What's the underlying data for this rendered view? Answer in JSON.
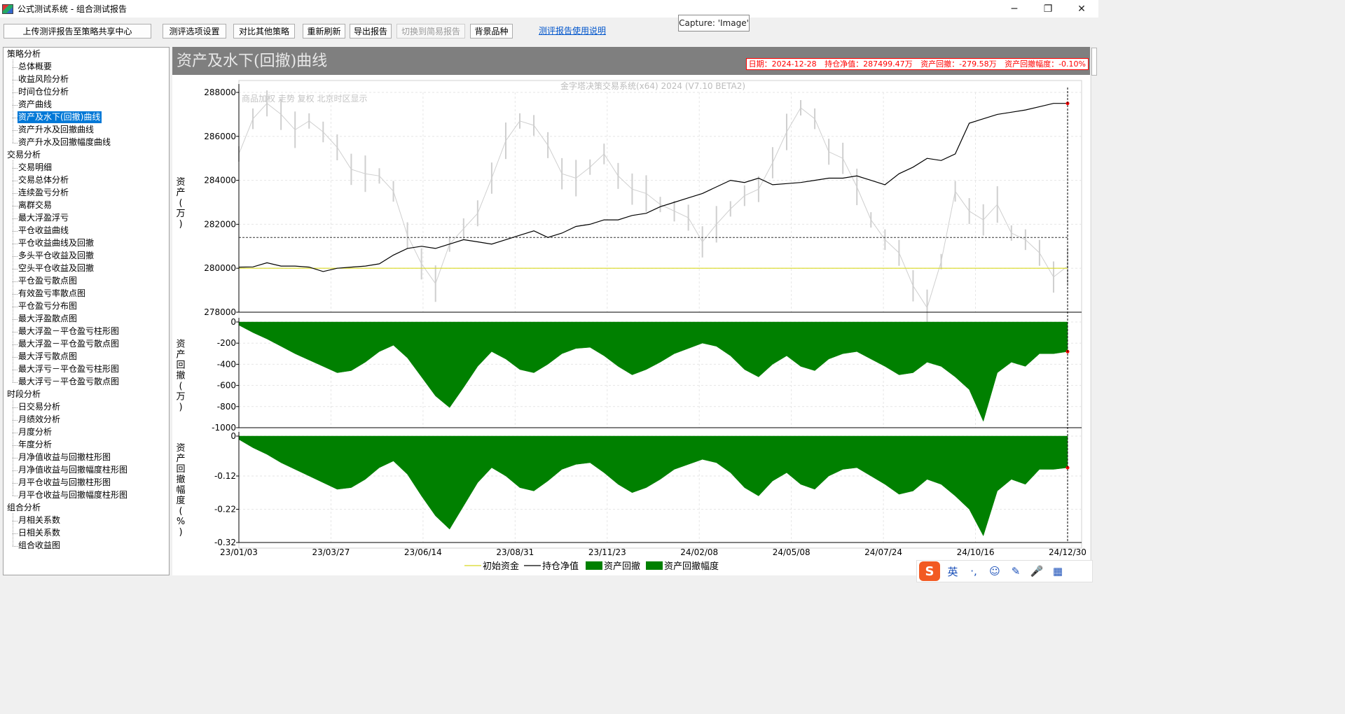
{
  "window": {
    "title": "公式测试系统 - 组合测试报告",
    "controls": {
      "minimize": "─",
      "restore": "❐",
      "close": "✕"
    }
  },
  "toolbar": {
    "upload": "上传测评报告至策略共享中心",
    "settings": "测评选项设置",
    "compare": "对比其他策略",
    "refresh": "重新刷新",
    "export": "导出报告",
    "switch_simple": "切换到简易报告",
    "background": "背景品种",
    "help_link": "测评报告使用说明"
  },
  "tooltip": {
    "text": "Capture: 'Image'"
  },
  "sidebar": {
    "groups": [
      {
        "label": "策略分析",
        "items": [
          "总体概要",
          "收益风险分析",
          "时间仓位分析",
          "资产曲线",
          "资产及水下(回撤)曲线",
          "资产升水及回撤曲线",
          "资产升水及回撤幅度曲线"
        ]
      },
      {
        "label": "交易分析",
        "items": [
          "交易明细",
          "交易总体分析",
          "连续盈亏分析",
          "离群交易",
          "最大浮盈浮亏",
          "平仓收益曲线",
          "平仓收益曲线及回撤",
          "多头平仓收益及回撤",
          "空头平仓收益及回撤",
          "平仓盈亏散点图",
          "有效盈亏率散点图",
          "平仓盈亏分布图",
          "最大浮盈散点图",
          "最大浮盈－平仓盈亏柱形图",
          "最大浮盈－平仓盈亏散点图",
          "最大浮亏散点图",
          "最大浮亏－平仓盈亏柱形图",
          "最大浮亏－平仓盈亏散点图"
        ]
      },
      {
        "label": "时段分析",
        "items": [
          "日交易分析",
          "月绩效分析",
          "月度分析",
          "年度分析",
          "月净值收益与回撤柱形图",
          "月净值收益与回撤幅度柱形图",
          "月平仓收益与回撤柱形图",
          "月平仓收益与回撤幅度柱形图"
        ]
      },
      {
        "label": "组合分析",
        "items": [
          "月相关系数",
          "日相关系数",
          "组合收益图"
        ]
      }
    ],
    "selected": "资产及水下(回撤)曲线"
  },
  "panel": {
    "title": "资产及水下(回撤)曲线",
    "info": {
      "date": "日期：2024-12-28",
      "net_value": "持仓净值：287499.47万",
      "drawdown": "资产回撤：-279.58万",
      "drawdown_pct": "资产回撤幅度：-0.10%"
    }
  },
  "chart_data": {
    "type": "line",
    "watermark": "金字塔决策交易系统(x64) 2024 (V7.10 BETA2)",
    "background_note": "商品加权 走势 复权 北京时区显示",
    "x_ticks": [
      "23/01/03",
      "23/03/27",
      "23/06/14",
      "23/08/31",
      "23/11/23",
      "24/02/08",
      "24/05/08",
      "24/07/24",
      "24/10/16",
      "24/12/30"
    ],
    "legend": [
      "初始资金",
      "持仓净值",
      "资产回撤",
      "资产回撤幅度"
    ],
    "colors": {
      "initial": "#d8d820",
      "net": "#000000",
      "background": "#cfcfcf",
      "drawdown": "#008000",
      "marker": "#ff0000"
    },
    "panels": [
      {
        "ylabel": "资产(万)",
        "ylim": [
          278000,
          288000
        ],
        "yticks": [
          278000,
          280000,
          282000,
          284000,
          286000,
          288000
        ],
        "initial_capital": 280000,
        "reference_line": 281400,
        "series": [
          {
            "name": "持仓净值",
            "values": [
              280050,
              280060,
              280250,
              280100,
              280100,
              280050,
              279850,
              280000,
              280050,
              280100,
              280200,
              280600,
              280900,
              281000,
              280900,
              281100,
              281300,
              281200,
              281100,
              281300,
              281500,
              281700,
              281400,
              281600,
              281900,
              282000,
              282200,
              282200,
              282400,
              282500,
              282800,
              283000,
              283200,
              283400,
              283700,
              284000,
              283900,
              284100,
              283800,
              283850,
              283900,
              284000,
              284100,
              284100,
              284200,
              284000,
              283800,
              284300,
              284600,
              285000,
              284900,
              285200,
              286600,
              286800,
              287000,
              287100,
              287200,
              287350,
              287500,
              287499
            ]
          }
        ],
        "background_series": [
          285200,
          286800,
          287500,
          287000,
          286300,
          286700,
          286200,
          285500,
          284500,
          284300,
          284200,
          283500,
          281500,
          280200,
          279300,
          281100,
          281800,
          282500,
          284100,
          285800,
          286700,
          286500,
          285600,
          284300,
          284100,
          284600,
          285200,
          284200,
          283600,
          283400,
          282900,
          282600,
          282300,
          281200,
          282000,
          282700,
          283300,
          283600,
          284800,
          286200,
          287300,
          286800,
          285300,
          285000,
          283700,
          282200,
          281300,
          280700,
          279200,
          278200,
          280300,
          283500,
          282600,
          282200,
          282900,
          281600,
          281300,
          280700,
          279600,
          280100
        ]
      },
      {
        "ylabel": "资产回撤(万)",
        "ylim": [
          -1000,
          0
        ],
        "yticks": [
          0,
          -200,
          -400,
          -600,
          -800,
          -1000
        ],
        "series": [
          {
            "name": "资产回撤",
            "values": [
              -30,
              -100,
              -160,
              -230,
              -300,
              -360,
              -420,
              -480,
              -460,
              -380,
              -280,
              -220,
              -340,
              -520,
              -700,
              -810,
              -620,
              -420,
              -280,
              -350,
              -450,
              -480,
              -400,
              -300,
              -250,
              -240,
              -320,
              -420,
              -500,
              -450,
              -380,
              -300,
              -250,
              -200,
              -230,
              -320,
              -450,
              -520,
              -400,
              -320,
              -420,
              -460,
              -350,
              -300,
              -280,
              -350,
              -420,
              -500,
              -480,
              -380,
              -420,
              -520,
              -640,
              -940,
              -480,
              -380,
              -420,
              -300,
              -300,
              -280
            ]
          }
        ]
      },
      {
        "ylabel": "资产回撤幅度(%)",
        "ylim": [
          -0.32,
          0
        ],
        "yticks": [
          0,
          -0.12,
          -0.22,
          -0.32
        ],
        "series": [
          {
            "name": "资产回撤幅度",
            "values": [
              -0.01,
              -0.035,
              -0.055,
              -0.08,
              -0.1,
              -0.12,
              -0.14,
              -0.16,
              -0.155,
              -0.13,
              -0.095,
              -0.075,
              -0.115,
              -0.18,
              -0.24,
              -0.28,
              -0.21,
              -0.14,
              -0.095,
              -0.12,
              -0.155,
              -0.165,
              -0.135,
              -0.1,
              -0.085,
              -0.08,
              -0.11,
              -0.145,
              -0.17,
              -0.155,
              -0.13,
              -0.1,
              -0.085,
              -0.07,
              -0.08,
              -0.11,
              -0.155,
              -0.18,
              -0.135,
              -0.11,
              -0.145,
              -0.16,
              -0.12,
              -0.1,
              -0.095,
              -0.12,
              -0.145,
              -0.175,
              -0.165,
              -0.13,
              -0.145,
              -0.18,
              -0.22,
              -0.3,
              -0.165,
              -0.13,
              -0.145,
              -0.1,
              -0.1,
              -0.095
            ]
          }
        ]
      }
    ]
  },
  "ime": {
    "logo": "S",
    "lang": "英",
    "punct": "·,",
    "emoji": "☺",
    "pen": "✎",
    "mic": "🎤",
    "grid": "▦"
  }
}
